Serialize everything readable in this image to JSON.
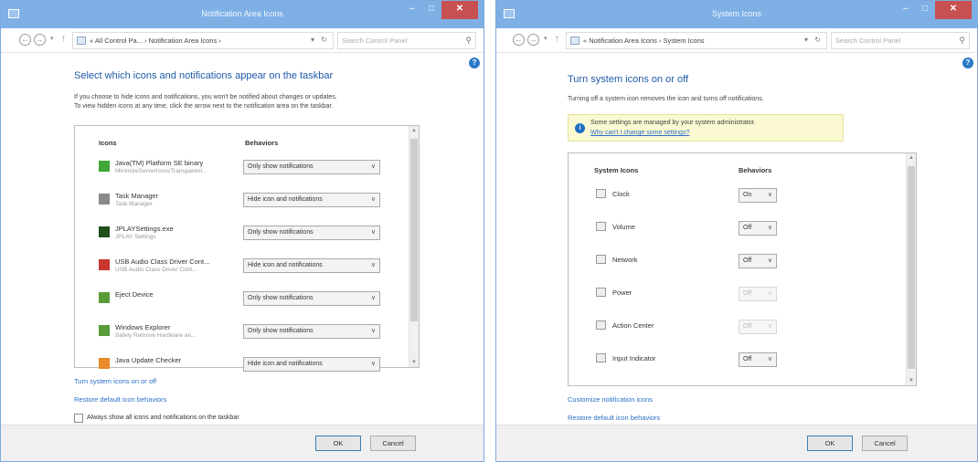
{
  "left": {
    "title": "Notification Area Icons",
    "address": {
      "crumbs": "« All Control Pa... › Notification Area Icons ›"
    },
    "search_placeholder": "Search Control Panel",
    "heading": "Select which icons and notifications appear on the taskbar",
    "description_line1": "If you choose to hide icons and notifications, you won't be notified about changes or updates.",
    "description_line2": "To view hidden icons at any time, click the arrow next to the notification area on the taskbar.",
    "col_icons": "Icons",
    "col_behaviors": "Behaviors",
    "rows": [
      {
        "name": "Java(TM) Platform SE binary",
        "sub": "MinimizeServerIconsTransparent...",
        "behavior": "Only show notifications",
        "icon": "java-icon",
        "color": "#3fa637"
      },
      {
        "name": "Task Manager",
        "sub": "Task Manager",
        "behavior": "Hide icon and notifications",
        "icon": "task-manager-icon",
        "color": "#8a8a8a"
      },
      {
        "name": "JPLAYSettings.exe",
        "sub": "JPLAY Settings",
        "behavior": "Only show notifications",
        "icon": "jplay-icon",
        "color": "#1d4f1d"
      },
      {
        "name": "USB Audio Class Driver Cont...",
        "sub": "USB Audio Class Driver Cont...",
        "behavior": "Hide icon and notifications",
        "icon": "usb-audio-icon",
        "color": "#c8362d"
      },
      {
        "name": "Eject Device",
        "sub": "",
        "behavior": "Only show notifications",
        "icon": "eject-device-icon",
        "color": "#5a9c3a"
      },
      {
        "name": "Windows Explorer",
        "sub": "Safely Remove Hardware an...",
        "behavior": "Only show notifications",
        "icon": "windows-explorer-icon",
        "color": "#5a9c3a"
      },
      {
        "name": "Java Update Checker",
        "sub": "",
        "behavior": "Hide icon and notifications",
        "icon": "java-update-icon",
        "color": "#e8892a"
      }
    ],
    "link_system_icons": "Turn system icons on or off",
    "link_restore": "Restore default icon behaviors",
    "checkbox_label": "Always show all icons and notifications on the taskbar",
    "ok": "OK",
    "cancel": "Cancel"
  },
  "right": {
    "title": "System Icons",
    "address": {
      "crumbs": "« Notification Area Icons › System Icons"
    },
    "search_placeholder": "Search Control Panel",
    "heading": "Turn system icons on or off",
    "description": "Turning off a system icon removes the icon and turns off notifications.",
    "notice_text": "Some settings are managed by your system administrator.",
    "notice_link": "Why can't I change some settings?",
    "col_icons": "System Icons",
    "col_behaviors": "Behaviors",
    "rows": [
      {
        "name": "Clock",
        "value": "On",
        "disabled": false,
        "icon": "clock-icon"
      },
      {
        "name": "Volume",
        "value": "Off",
        "disabled": false,
        "icon": "volume-icon"
      },
      {
        "name": "Network",
        "value": "Off",
        "disabled": false,
        "icon": "network-icon"
      },
      {
        "name": "Power",
        "value": "Off",
        "disabled": true,
        "icon": "power-icon"
      },
      {
        "name": "Action Center",
        "value": "Off",
        "disabled": true,
        "icon": "action-center-icon"
      },
      {
        "name": "Input Indicator",
        "value": "Off",
        "disabled": false,
        "icon": "input-indicator-icon"
      }
    ],
    "link_customize": "Customize notification icons",
    "link_restore": "Restore default icon behaviors",
    "ok": "OK",
    "cancel": "Cancel"
  }
}
